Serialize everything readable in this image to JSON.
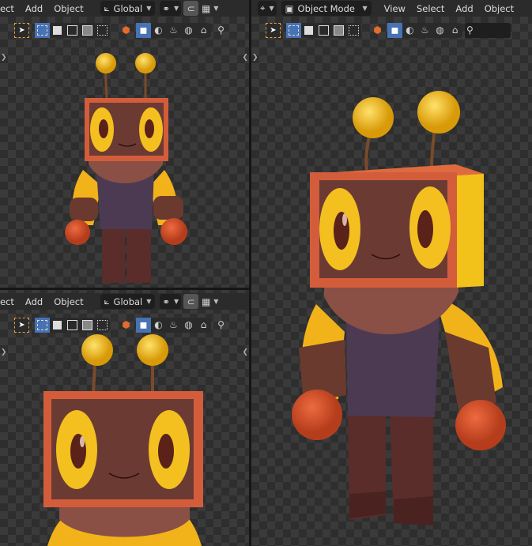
{
  "top_left": {
    "menus": [
      "ect",
      "Add",
      "Object"
    ],
    "orientation": "Global"
  },
  "bottom_left": {
    "menus": [
      "ect",
      "Add",
      "Object"
    ],
    "orientation": "Global"
  },
  "right": {
    "mode": "Object Mode",
    "menus": [
      "View",
      "Select",
      "Add",
      "Object"
    ]
  },
  "icons": {
    "select": "cursor-select-icon",
    "transform": "transform-orientation-icon",
    "pivot": "pivot-icon",
    "snap": "snap-icon",
    "grid": "grid-icon",
    "shading": [
      "wireframe-icon",
      "solid-icon",
      "material-icon",
      "rendered-icon"
    ],
    "search": "search-icon"
  },
  "colors": {
    "accent": "#4772b3",
    "header": "#2b2b2b",
    "checker_light": "#3a3a3a",
    "checker_dark": "#2e2e2e",
    "robot_body": "#6b3b33",
    "robot_yellow": "#f3b91b",
    "robot_frame": "#d35d3b"
  }
}
